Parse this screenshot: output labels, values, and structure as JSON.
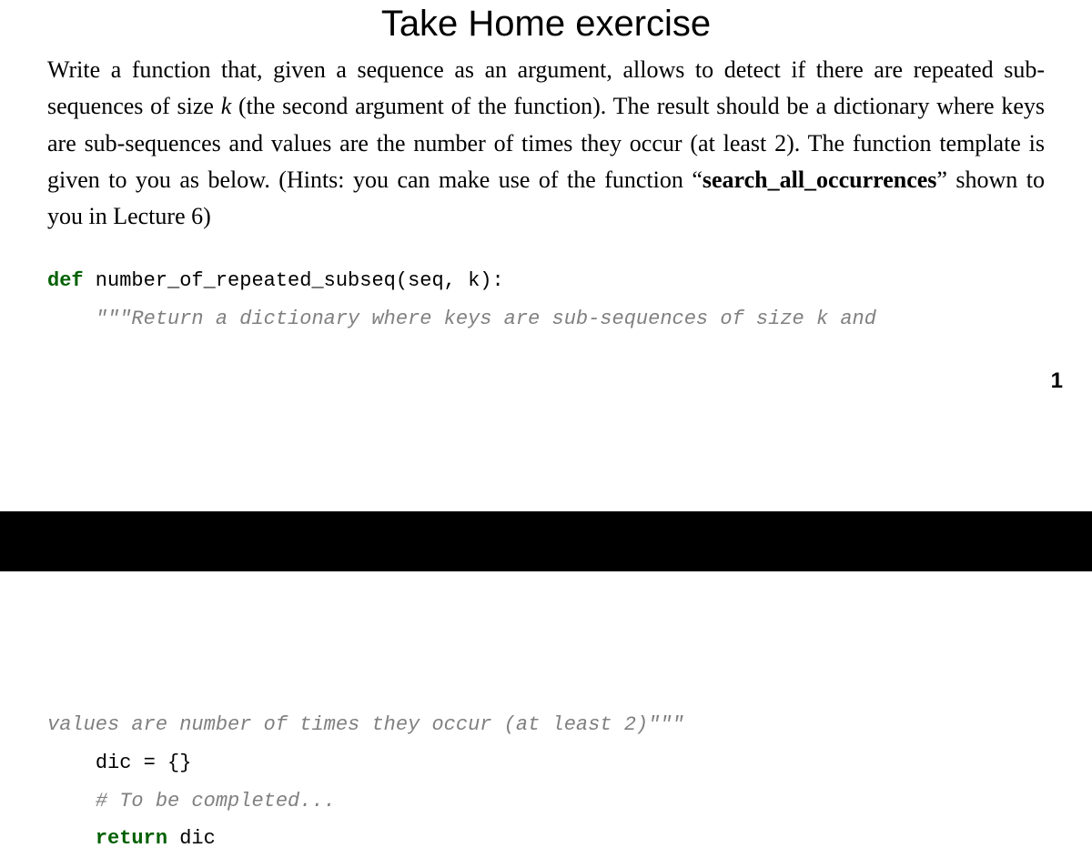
{
  "title": "Take Home exercise",
  "prose": {
    "t1": "Write a function that, given a sequence as an argument, allows to detect if there are repeated sub-sequences of size ",
    "k": "k",
    "t2": " (the second argument of the function). The result should be a dictionary where keys are sub-sequences and values are the number of times they occur (at least 2). The function template is given to you as below. (Hints: you can make use of the function “",
    "fn": "search_all_occurrences",
    "t3": "” shown to you in Lecture 6)"
  },
  "code_top": {
    "def": "def",
    "sig": " number_of_repeated_subseq(seq, k):",
    "indent1": "    ",
    "doc1": "\"\"\"Return a dictionary where keys are sub-sequences of size k and"
  },
  "page": "1",
  "code_bot": {
    "doc2": "values are number of times they occur (at least 2)\"\"\"",
    "indent1": "    ",
    "dic_line": "dic = {}",
    "comment": "# To be completed...",
    "ret": "return",
    "ret_tail": " dic"
  }
}
